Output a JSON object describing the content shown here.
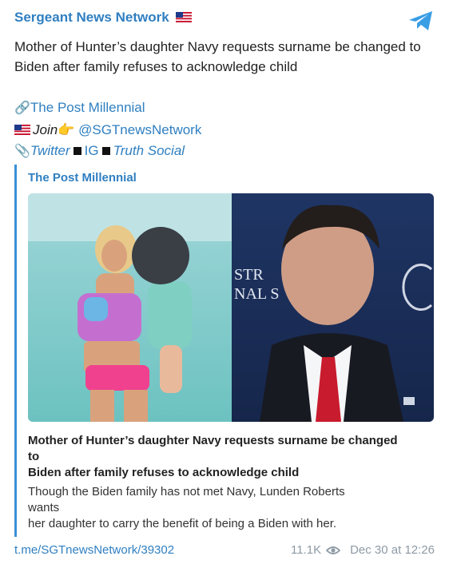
{
  "channel": {
    "name": "Sergeant News Network",
    "flag_icon": "us-flag-icon"
  },
  "message": {
    "text": "Mother of Hunter’s daughter Navy requests surname be changed to Biden after family refuses to acknowledge child",
    "source_link": "The Post Millennial",
    "join_label": "Join",
    "join_emoji": "👉",
    "join_handle": "@SGTnewsNetwork",
    "social": {
      "twitter": "Twitter",
      "ig": "IG",
      "truth": "Truth Social"
    }
  },
  "preview": {
    "source": "The Post Millennial",
    "title": "Mother of Hunter’s daughter Navy requests surname be changed to\nBiden after family refuses to acknowledge child",
    "title_line1": "Mother of Hunter’s daughter Navy requests surname be changed",
    "title_line2": "to",
    "title_line3": "Biden after family refuses to acknowledge child",
    "desc_line1": "Though the Biden family has not met Navy, Lunden Roberts",
    "desc_line2": "wants",
    "desc_line3": "her daughter to carry the benefit of being a Biden with her.",
    "image_text_left": "STR",
    "image_text_left2": "NAL S"
  },
  "footer": {
    "link": "t.me/SGTnewsNetwork/39302",
    "views": "11.1K",
    "date": "Dec 30 at 12:26"
  },
  "colors": {
    "accent": "#2f7fc1",
    "telegram": "#3a9ee4",
    "meta": "#8e9aa5"
  }
}
